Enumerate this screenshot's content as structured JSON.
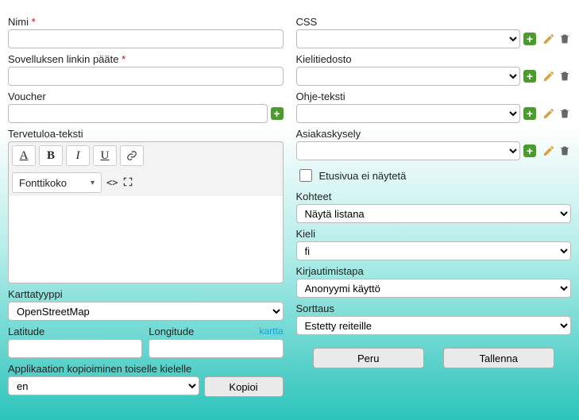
{
  "left": {
    "name_label": "Nimi",
    "link_suffix_label": "Sovelluksen linkin pääte",
    "voucher_label": "Voucher",
    "welcome_text_label": "Tervetuloa-teksti",
    "fontsize_label": "Fonttikoko",
    "maptype_label": "Karttatyyppi",
    "maptype_value": "OpenStreetMap",
    "latitude_label": "Latitude",
    "longitude_label": "Longitude",
    "map_link": "kartta",
    "copy_app_label": "Applikaation kopioiminen toiselle kielelle",
    "copy_lang_value": "en",
    "copy_button": "Kopioi"
  },
  "right": {
    "css_label": "CSS",
    "langfile_label": "Kielitiedosto",
    "helptext_label": "Ohje-teksti",
    "survey_label": "Asiakaskysely",
    "hide_home_label": "Etusivua ei näytetä",
    "targets_label": "Kohteet",
    "targets_value": "Näytä listana",
    "lang_label": "Kieli",
    "lang_value": "fi",
    "login_label": "Kirjautimistapa",
    "login_value": "Anonyymi käyttö",
    "sort_label": "Sorttaus",
    "sort_value": "Estetty reiteille",
    "cancel": "Peru",
    "save": "Tallenna"
  }
}
